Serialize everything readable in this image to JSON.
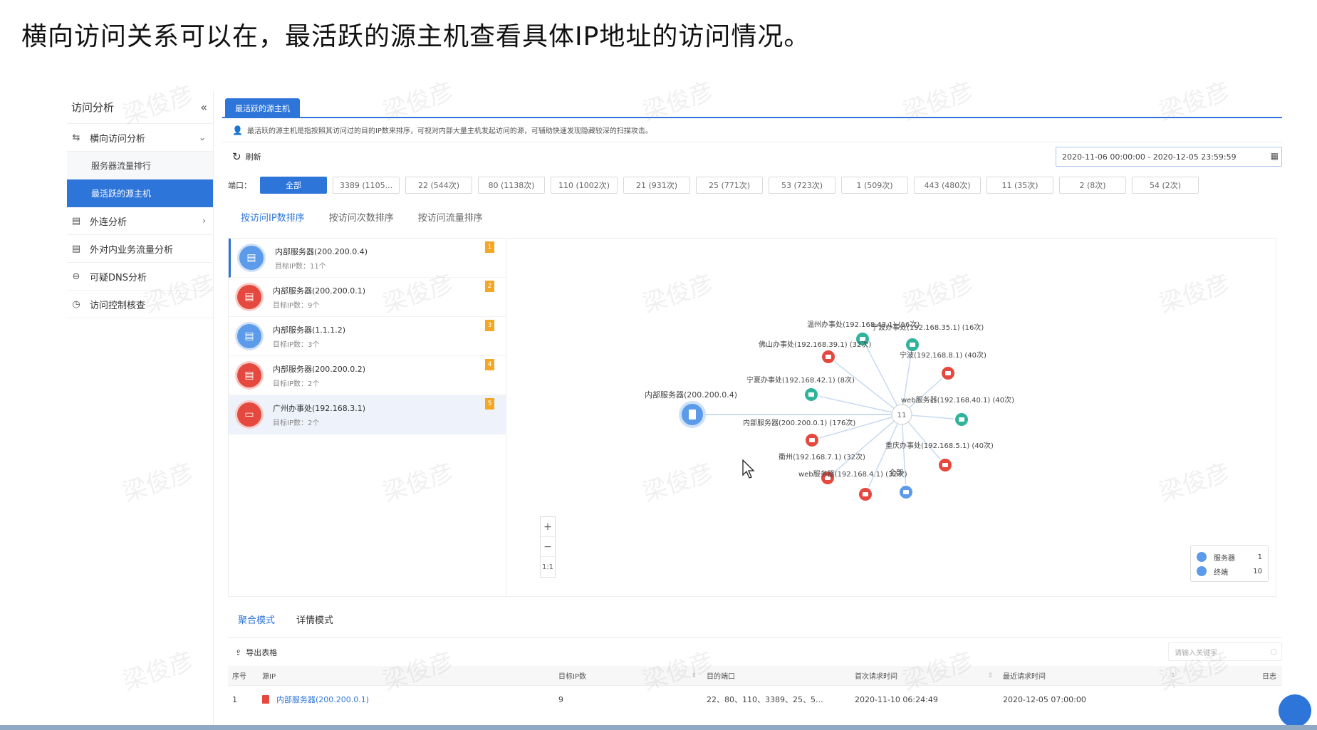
{
  "slide_title": "横向访问关系可以在，最活跃的源主机查看具体IP地址的访问情况。",
  "watermark": "梁俊彦",
  "sidebar": {
    "header": "访问分析",
    "collapse_icon": "double-chevron-left-icon",
    "items": [
      {
        "label": "横向访问分析",
        "icon": "lateral-icon",
        "expanded": true
      },
      {
        "label": "外连分析",
        "icon": "outbound-icon"
      },
      {
        "label": "外对内业务流量分析",
        "icon": "traffic-icon"
      },
      {
        "label": "可疑DNS分析",
        "icon": "dns-icon"
      },
      {
        "label": "访问控制核查",
        "icon": "clock-icon"
      }
    ],
    "subitems": [
      {
        "label": "服务器流量排行"
      },
      {
        "label": "最活跃的源主机",
        "active": true
      }
    ]
  },
  "main": {
    "tab_label": "最活跃的源主机",
    "notice": "最活跃的源主机是指按照其访问过的目的IP数来排序，可视对内部大量主机发起访问的源，可辅助快速发现隐藏较深的扫描攻击。",
    "refresh_label": "刷新",
    "date_range": "2020-11-06 00:00:00 - 2020-12-05 23:59:59",
    "port_label": "端口：",
    "ports": [
      "全部",
      "3389 (1105...",
      "22 (544次)",
      "80 (1138次)",
      "110 (1002次)",
      "21 (931次)",
      "25 (771次)",
      "53 (723次)",
      "1 (509次)",
      "443 (480次)",
      "11 (35次)",
      "2 (8次)",
      "54 (2次)"
    ],
    "sort_tabs": [
      "按访问IP数排序",
      "按访问次数排序",
      "按访问流量排序"
    ],
    "ranking": [
      {
        "name": "内部服务器(200.200.0.4)",
        "sub": "目标IP数：11个",
        "rank": "1",
        "color": "blue",
        "icon": "server-icon"
      },
      {
        "name": "内部服务器(200.200.0.1)",
        "sub": "目标IP数：9个",
        "rank": "2",
        "color": "red",
        "icon": "server-icon"
      },
      {
        "name": "内部服务器(1.1.1.2)",
        "sub": "目标IP数：3个",
        "rank": "3",
        "color": "blue",
        "icon": "server-icon"
      },
      {
        "name": "内部服务器(200.200.0.2)",
        "sub": "目标IP数：2个",
        "rank": "4",
        "color": "red",
        "icon": "server-icon"
      },
      {
        "name": "广州办事处(192.168.3.1)",
        "sub": "目标IP数：2个",
        "rank": "5",
        "color": "red",
        "icon": "monitor-icon"
      }
    ],
    "graph": {
      "source": {
        "label": "内部服务器(200.200.0.4)",
        "type": "server",
        "color": "blue"
      },
      "hub_label": "11",
      "targets": [
        {
          "label": "温州办事处(192.168.43.1) (16次)",
          "color": "green"
        },
        {
          "label": "宁波办事处(192.168.35.1) (16次)",
          "color": "green"
        },
        {
          "label": "佛山办事处(192.168.39.1) (32次)",
          "color": "red"
        },
        {
          "label": "宁波(192.168.8.1) (40次)",
          "color": "red"
        },
        {
          "label": "宁夏办事处(192.168.42.1) (8次)",
          "color": "green"
        },
        {
          "label": "web服务器(192.168.40.1) (40次)",
          "color": "green"
        },
        {
          "label": "内部服务器(200.200.0.1) (176次)",
          "color": "red"
        },
        {
          "label": "重庆办事处(192.168.5.1) (40次)",
          "color": "red"
        },
        {
          "label": "衢州(192.168.7.1) (32次)",
          "color": "red"
        },
        {
          "label": "web服务器(192.168.4.1) (32次)",
          "color": "red"
        },
        {
          "label": "全部",
          "color": "blue"
        }
      ],
      "zoom_in": "+",
      "zoom_out": "−",
      "zoom_reset": "1:1",
      "legend": [
        {
          "label": "服务器",
          "count": "1"
        },
        {
          "label": "终端",
          "count": "10"
        }
      ]
    },
    "bottom_tabs": [
      "聚合模式",
      "详情模式"
    ],
    "export_label": "导出表格",
    "search_placeholder": "请输入关键字",
    "table": {
      "headers": [
        "序号",
        "源IP",
        "目标IP数",
        "目的端口",
        "首次请求时间",
        "最近请求时间",
        "日志"
      ],
      "rows": [
        {
          "index": "1",
          "source_ip": "内部服务器(200.200.0.1)",
          "target_count": "9",
          "ports": "22、80、110、3389、25、5...",
          "first_time": "2020-11-10 06:24:49",
          "last_time": "2020-12-05 07:00:00"
        }
      ]
    }
  },
  "colors": {
    "accent": "#2e75d9",
    "red": "#e5483e",
    "green": "#2fb39a",
    "blue": "#5b9bea",
    "badge": "#f5a623"
  }
}
